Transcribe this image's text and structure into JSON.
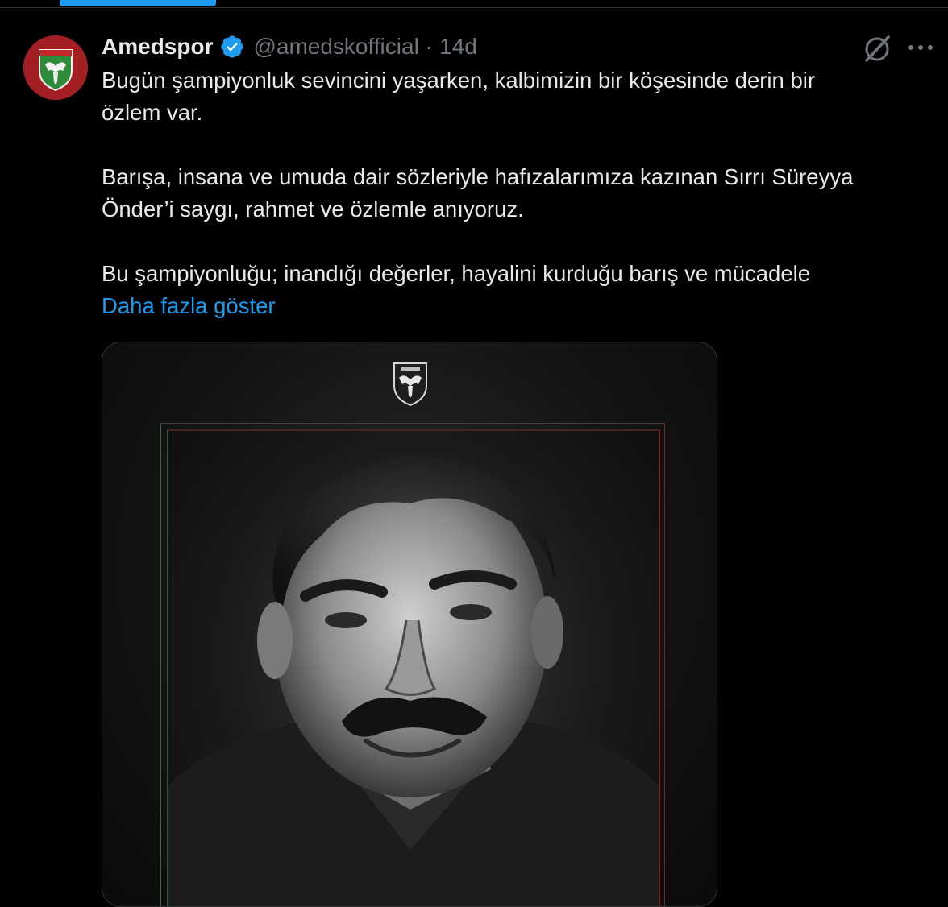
{
  "tweet": {
    "author_name": "Amedspor",
    "handle": "@amedskofficial",
    "separator": "·",
    "time": "14d",
    "text_lines": [
      "Bugün şampiyonluk sevincini yaşarken, kalbimizin bir köşesinde derin bir",
      "özlem var.",
      "Barışa, insana ve umuda dair sözleriyle hafızalarımıza kazınan Sırrı Süreyya",
      "Önder’i saygı, rahmet ve özlemle anıyoruz.",
      "Bu şampiyonluğu; inandığı değerler, hayalini kurduğu barış ve mücadele"
    ],
    "show_more": "Daha fazla göster"
  },
  "icons": {
    "verified": "verified-badge-icon",
    "grok": "grok-icon",
    "more": "more-icon",
    "avatar_logo": "amedspor-crest-icon"
  },
  "colors": {
    "background": "#000000",
    "text": "#e7e9ea",
    "muted": "#71767b",
    "accent": "#1d9bf0",
    "avatar_bg": "#a31f24",
    "crest_green": "#2e8b3a"
  }
}
